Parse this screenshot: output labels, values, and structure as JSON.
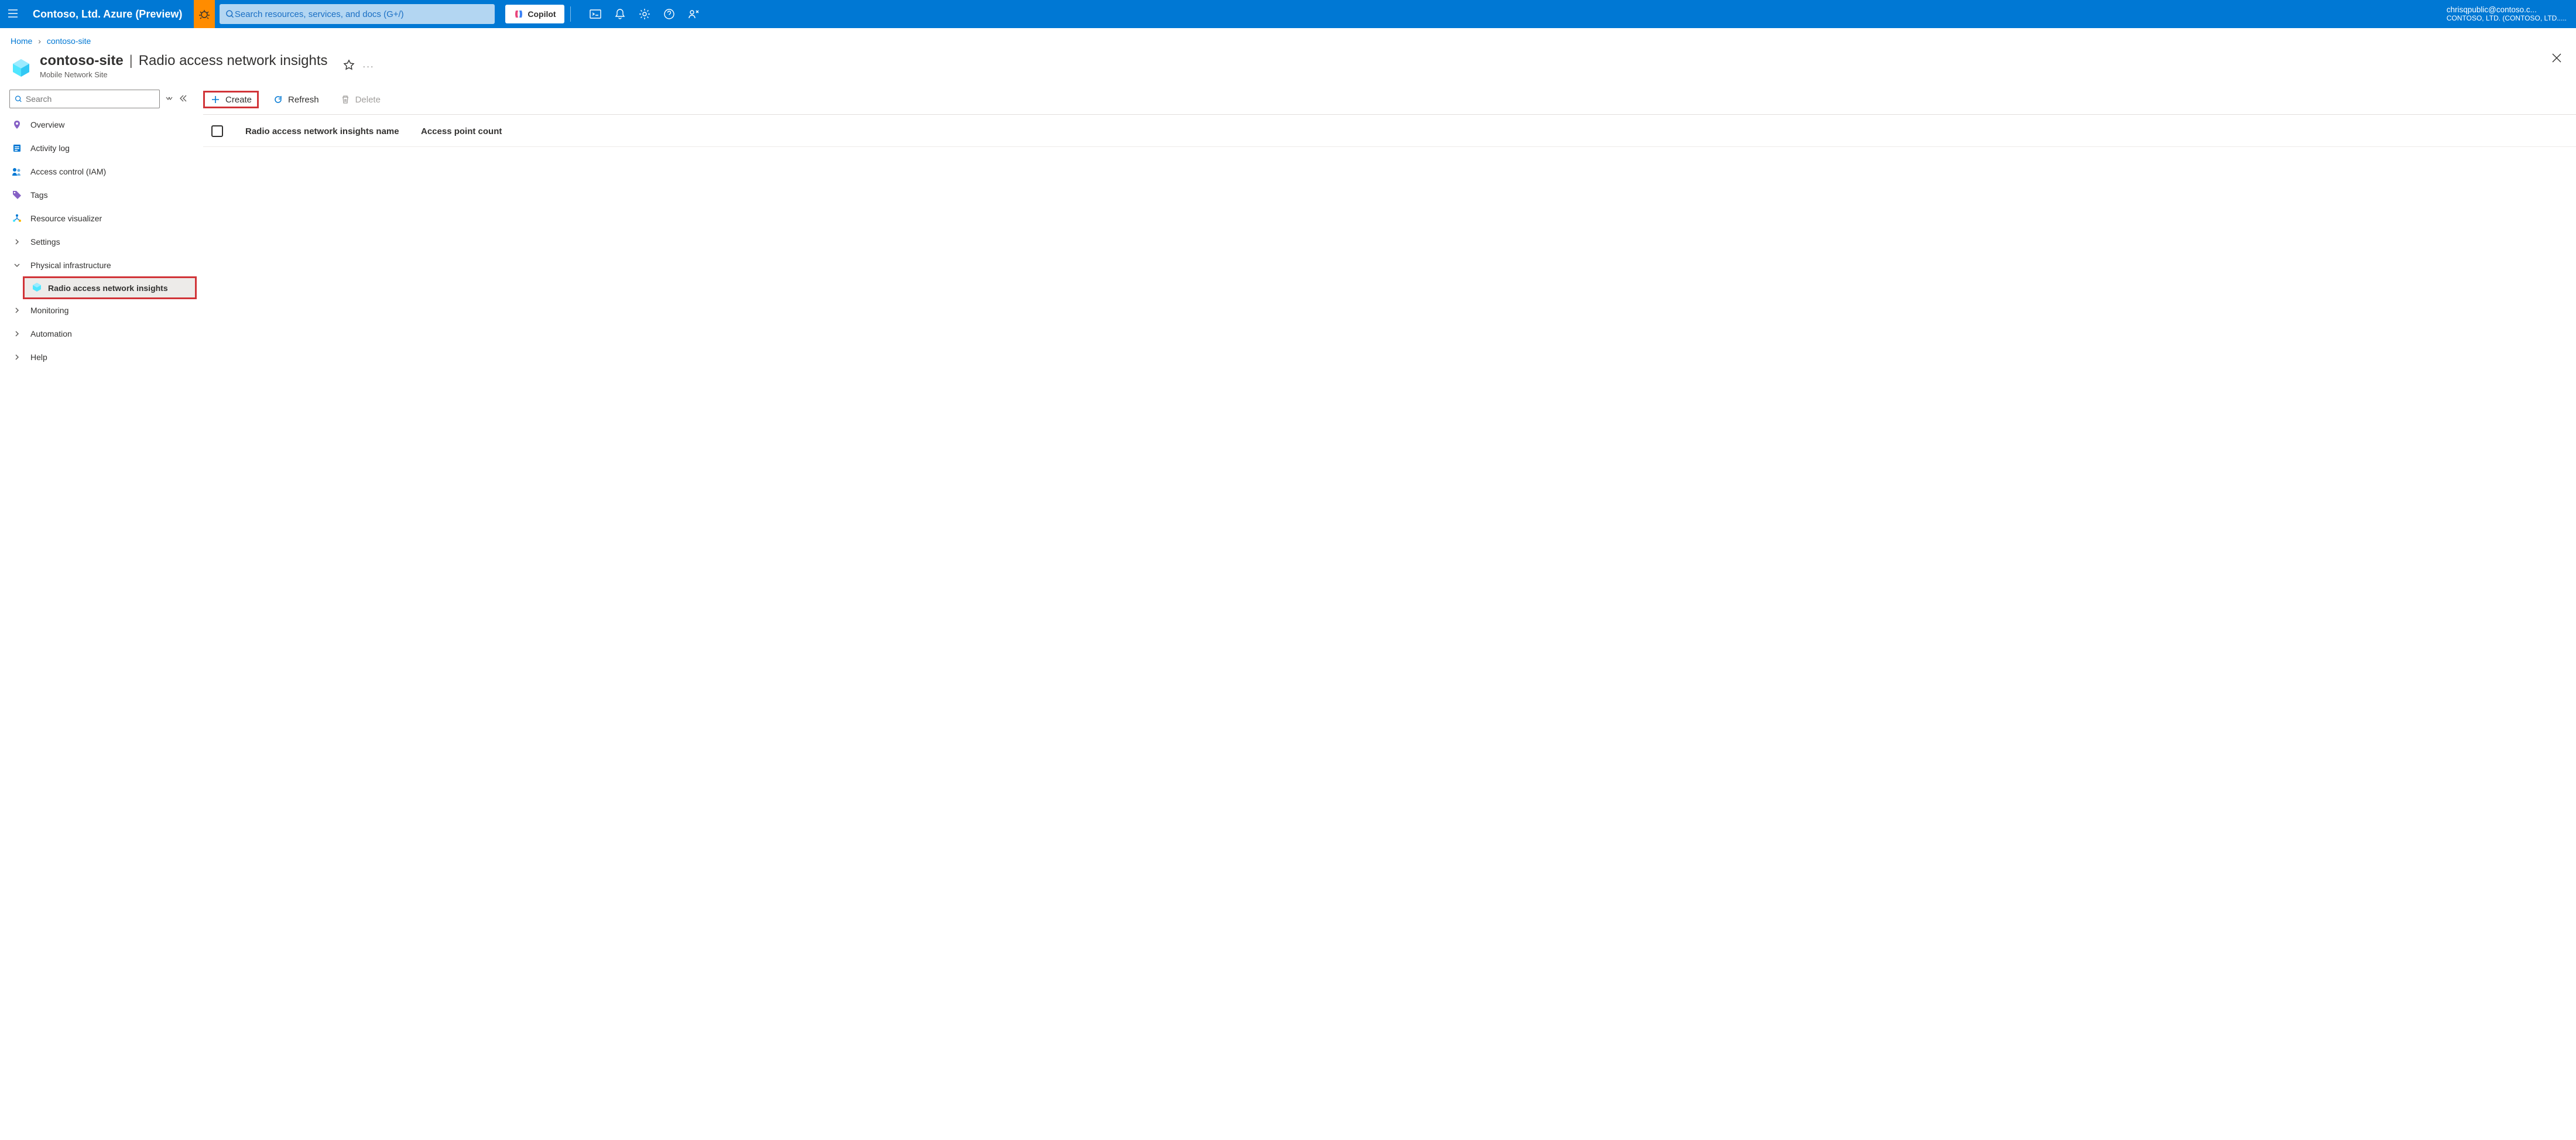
{
  "header": {
    "brand": "Contoso, Ltd. Azure (Preview)",
    "search_placeholder": "Search resources, services, and docs (G+/)",
    "copilot": "Copilot",
    "account_email": "chrisqpublic@contoso.c...",
    "account_dir": "CONTOSO, LTD. (CONTOSO, LTD....."
  },
  "breadcrumb": {
    "home": "Home",
    "current": "contoso-site"
  },
  "title": {
    "resource": "contoso-site",
    "page": "Radio access network insights",
    "subtitle": "Mobile Network Site"
  },
  "sidebar": {
    "search_placeholder": "Search",
    "items": {
      "overview": "Overview",
      "activity": "Activity log",
      "access": "Access control (IAM)",
      "tags": "Tags",
      "visualizer": "Resource visualizer",
      "settings": "Settings",
      "physical": "Physical infrastructure",
      "radio": "Radio access network insights",
      "monitoring": "Monitoring",
      "automation": "Automation",
      "help": "Help"
    }
  },
  "toolbar": {
    "create": "Create",
    "refresh": "Refresh",
    "delete": "Delete"
  },
  "table": {
    "col1": "Radio access network insights name",
    "col2": "Access point count"
  }
}
